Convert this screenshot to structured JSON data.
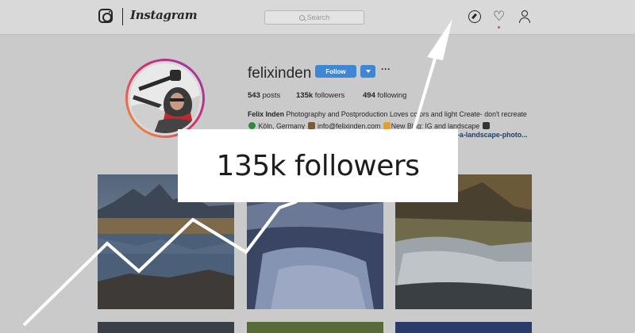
{
  "app": {
    "wordmark": "Instagram"
  },
  "nav": {
    "search_placeholder": "Search",
    "icons": [
      "instagram-logo-icon",
      "explore-compass-icon",
      "activity-heart-icon",
      "profile-person-icon"
    ],
    "notification_dot_color": "#ed4956"
  },
  "profile": {
    "username": "felixinden",
    "follow_label": "Follow",
    "more_label": "···",
    "stats": {
      "posts_count": "543",
      "posts_label": " posts",
      "followers_count": "135k",
      "followers_label": " followers",
      "following_count": "494",
      "following_label": " following"
    },
    "bio": {
      "name": "Felix Inden",
      "text1": " Photography and Postproduction Loves colors and light Create- don't recreate ",
      "text2": " Köln, Germany ",
      "text3": " info@felixinden.com ",
      "text4": "New Blog: IG and landscape ",
      "link": "-a-landscape-photo..."
    }
  },
  "overlay": {
    "text": "135k followers"
  },
  "colors": {
    "follow_button": "#3f86d5",
    "background": "#cacaca",
    "arrow": "#ffffff"
  }
}
